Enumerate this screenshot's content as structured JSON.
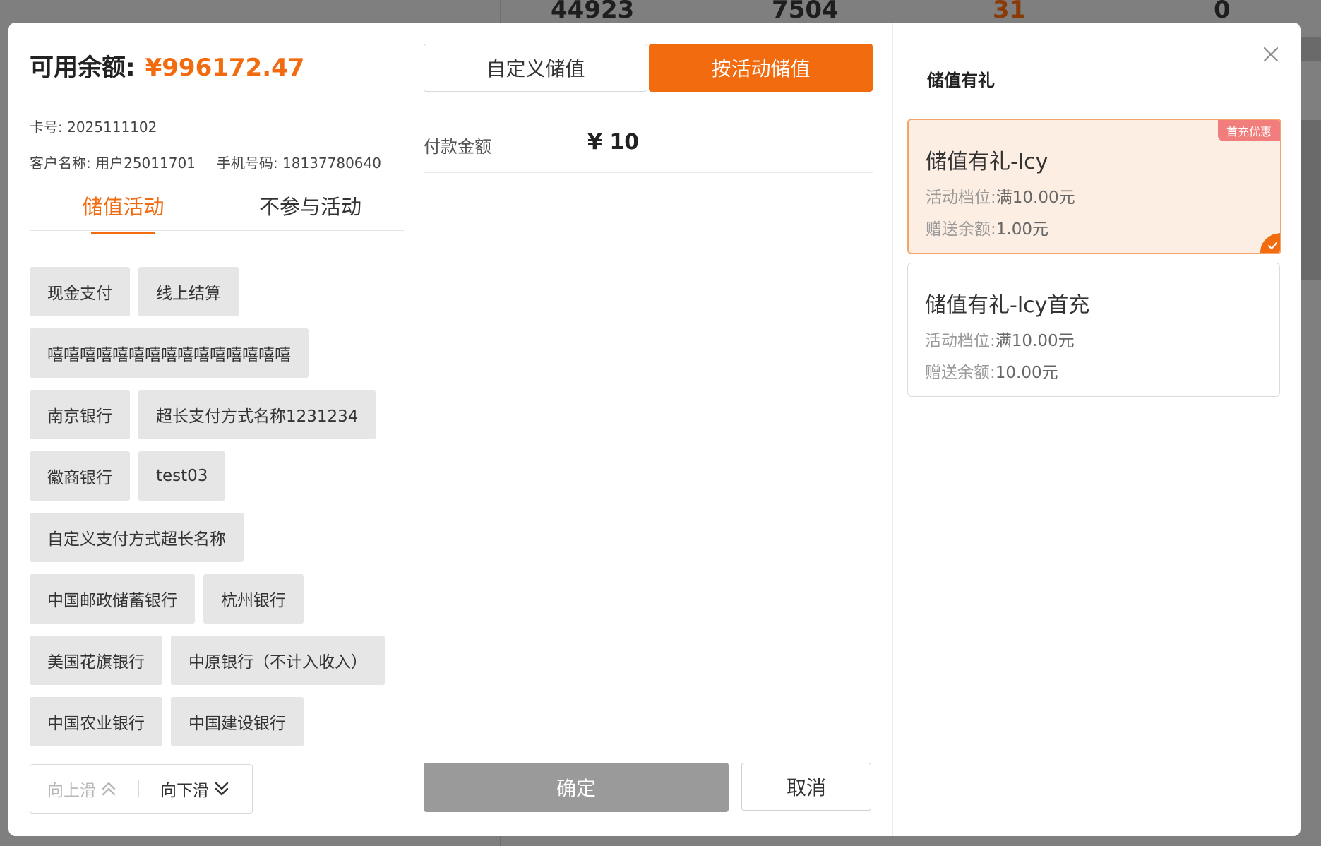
{
  "background": {
    "stats": [
      "44923",
      "7504",
      "31",
      "0"
    ]
  },
  "account": {
    "balance_label": "可用余额:",
    "balance_value": "¥996172.47",
    "card_no": "卡号: 2025111102",
    "customer_name": "客户名称: 用户25011701",
    "phone": "手机号码: 18137780640"
  },
  "activity_tabs": [
    {
      "label": "储值活动",
      "active": true
    },
    {
      "label": "不参与活动",
      "active": false
    }
  ],
  "payment_methods": [
    [
      "现金支付",
      "线上结算"
    ],
    [
      "嘻嘻嘻嘻嘻嘻嘻嘻嘻嘻嘻嘻嘻嘻嘻"
    ],
    [
      "南京银行",
      "超长支付方式名称1231234"
    ],
    [
      "徽商银行",
      "test03"
    ],
    [
      "自定义支付方式超长名称"
    ],
    [
      "中国邮政储蓄银行",
      "杭州银行"
    ],
    [
      "美国花旗银行",
      "中原银行（不计入收入）"
    ],
    [
      "中国农业银行",
      "中国建设银行"
    ]
  ],
  "scroll": {
    "up_label": "向上滑",
    "down_label": "向下滑"
  },
  "recharge_mode": {
    "custom_label": "自定义储值",
    "activity_label": "按活动储值",
    "active": "activity"
  },
  "payment": {
    "amount_label": "付款金额",
    "amount_value": "¥ 10"
  },
  "actions": {
    "confirm_label": "确定",
    "cancel_label": "取消"
  },
  "promotions": {
    "title": "储值有礼",
    "items": [
      {
        "name": "储值有礼-lcy",
        "tier_label": "活动档位:",
        "tier_value": "满10.00元",
        "bonus_label": "赠送余额:",
        "bonus_value": "1.00元",
        "badge": "首充优惠",
        "selected": true
      },
      {
        "name": "储值有礼-lcy首充",
        "tier_label": "活动档位:",
        "tier_value": "满10.00元",
        "bonus_label": "赠送余额:",
        "bonus_value": "10.00元",
        "badge": "",
        "selected": false
      }
    ]
  },
  "colors": {
    "accent": "#f26b0f",
    "badge": "#f27d7d",
    "confirm_disabled": "#9a9a9a"
  }
}
